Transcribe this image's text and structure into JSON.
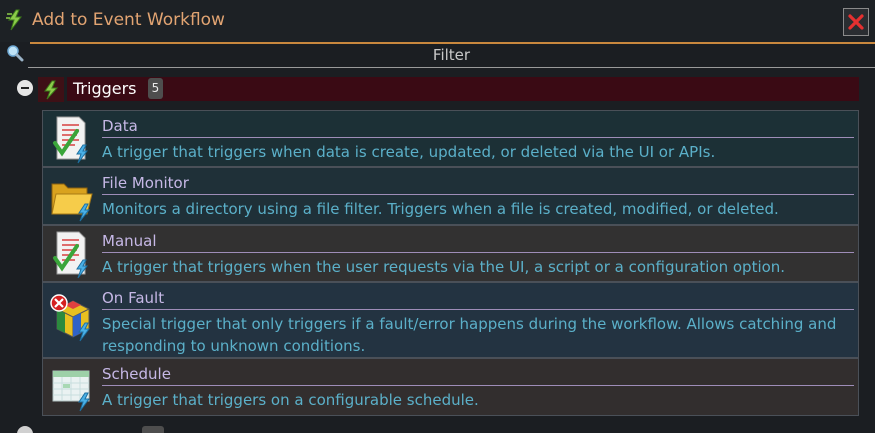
{
  "window": {
    "title": "Add to Event Workflow",
    "icon": "lightning-workflow-icon",
    "close_icon": "close-icon"
  },
  "filter": {
    "placeholder": "Filter",
    "icon": "search-icon"
  },
  "group": {
    "label": "Triggers",
    "count": "5",
    "icon": "lightning-icon",
    "toggle_icon": "collapse-icon"
  },
  "items": [
    {
      "title": "Data",
      "description": "A trigger that triggers when data is create, updated, or deleted via the UI or APIs.",
      "icon": "document-checkmark-icon",
      "bg": "#1c3036"
    },
    {
      "title": "File Monitor",
      "description": "Monitors a directory using a file filter. Triggers when a file is created, modified, or deleted.",
      "icon": "folder-icon",
      "bg": "#1f3038"
    },
    {
      "title": "Manual",
      "description": "A trigger that triggers when the user requests via the UI, a script or a configuration option.",
      "icon": "document-checkmark-icon",
      "bg": "#323131"
    },
    {
      "title": "On Fault",
      "description": "Special trigger that only triggers if a fault/error happens during the workflow. Allows catching and responding to unknown conditions.",
      "icon": "fault-cube-icon",
      "bg": "#233341"
    },
    {
      "title": "Schedule",
      "description": "A trigger that triggers on a configurable schedule.",
      "icon": "calendar-icon",
      "bg": "#322e2e"
    }
  ],
  "next_group": {
    "label": "",
    "count": ""
  },
  "colors": {
    "accent": "#c9883e",
    "title_text": "#e2a472",
    "item_title": "#c6b8e6",
    "item_desc": "#5bb0c9",
    "group_bg": "#3a0a14"
  }
}
